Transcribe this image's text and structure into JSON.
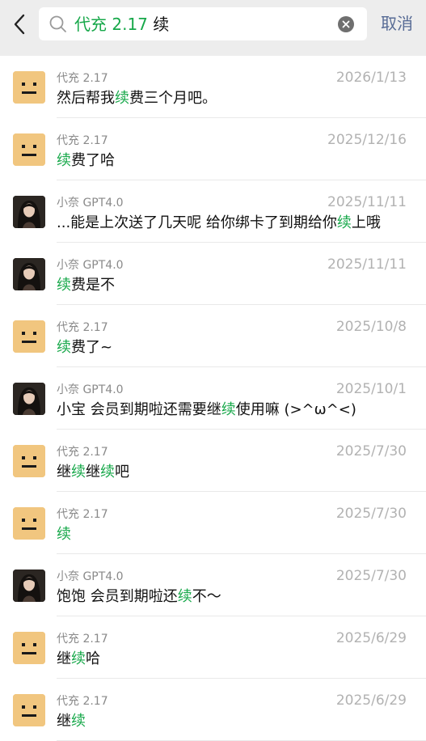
{
  "search": {
    "keyword_prefix": "代充 2.17",
    "query": "续",
    "cancel_label": "取消"
  },
  "results": [
    {
      "sender": "代充 2.17",
      "date": "2026/1/13",
      "avatar": "emoji",
      "msg": [
        {
          "t": "然后帮我",
          "h": false
        },
        {
          "t": "续",
          "h": true
        },
        {
          "t": "费三个月吧。",
          "h": false
        }
      ]
    },
    {
      "sender": "代充 2.17",
      "date": "2025/12/16",
      "avatar": "emoji",
      "msg": [
        {
          "t": "续",
          "h": true
        },
        {
          "t": "费了哈",
          "h": false
        }
      ]
    },
    {
      "sender": "小奈 GPT4.0",
      "date": "2025/11/11",
      "avatar": "photo",
      "msg": [
        {
          "t": "...能是上次送了几天呢 给你绑卡了到期给你",
          "h": false
        },
        {
          "t": "续",
          "h": true
        },
        {
          "t": "上哦",
          "h": false
        }
      ]
    },
    {
      "sender": "小奈 GPT4.0",
      "date": "2025/11/11",
      "avatar": "photo",
      "msg": [
        {
          "t": "续",
          "h": true
        },
        {
          "t": "费是不",
          "h": false
        }
      ]
    },
    {
      "sender": "代充 2.17",
      "date": "2025/10/8",
      "avatar": "emoji",
      "msg": [
        {
          "t": "续",
          "h": true
        },
        {
          "t": "费了~",
          "h": false
        }
      ]
    },
    {
      "sender": "小奈 GPT4.0",
      "date": "2025/10/1",
      "avatar": "photo",
      "msg": [
        {
          "t": "小宝 会员到期啦还需要继",
          "h": false
        },
        {
          "t": "续",
          "h": true
        },
        {
          "t": "使用嘛 (>^ω^<)",
          "h": false
        }
      ]
    },
    {
      "sender": "代充 2.17",
      "date": "2025/7/30",
      "avatar": "emoji",
      "msg": [
        {
          "t": "继",
          "h": false
        },
        {
          "t": "续",
          "h": true
        },
        {
          "t": "继",
          "h": false
        },
        {
          "t": "续",
          "h": true
        },
        {
          "t": "吧",
          "h": false
        }
      ]
    },
    {
      "sender": "代充 2.17",
      "date": "2025/7/30",
      "avatar": "emoji",
      "msg": [
        {
          "t": "续",
          "h": true
        }
      ]
    },
    {
      "sender": "小奈 GPT4.0",
      "date": "2025/7/30",
      "avatar": "photo",
      "msg": [
        {
          "t": "饱饱 会员到期啦还",
          "h": false
        },
        {
          "t": "续",
          "h": true
        },
        {
          "t": "不～",
          "h": false
        }
      ]
    },
    {
      "sender": "代充 2.17",
      "date": "2025/6/29",
      "avatar": "emoji",
      "msg": [
        {
          "t": "继",
          "h": false
        },
        {
          "t": "续",
          "h": true
        },
        {
          "t": "哈",
          "h": false
        }
      ]
    },
    {
      "sender": "代充 2.17",
      "date": "2025/6/29",
      "avatar": "emoji",
      "msg": [
        {
          "t": "继",
          "h": false
        },
        {
          "t": "续",
          "h": true
        }
      ]
    }
  ],
  "icons": {
    "back": "chevron-left-icon",
    "search": "search-icon",
    "clear": "clear-icon"
  },
  "colors": {
    "highlight": "#17a84a",
    "link": "#576b95",
    "header_bg": "#ededed",
    "emoji_avatar_bg": "#f1c67f"
  }
}
